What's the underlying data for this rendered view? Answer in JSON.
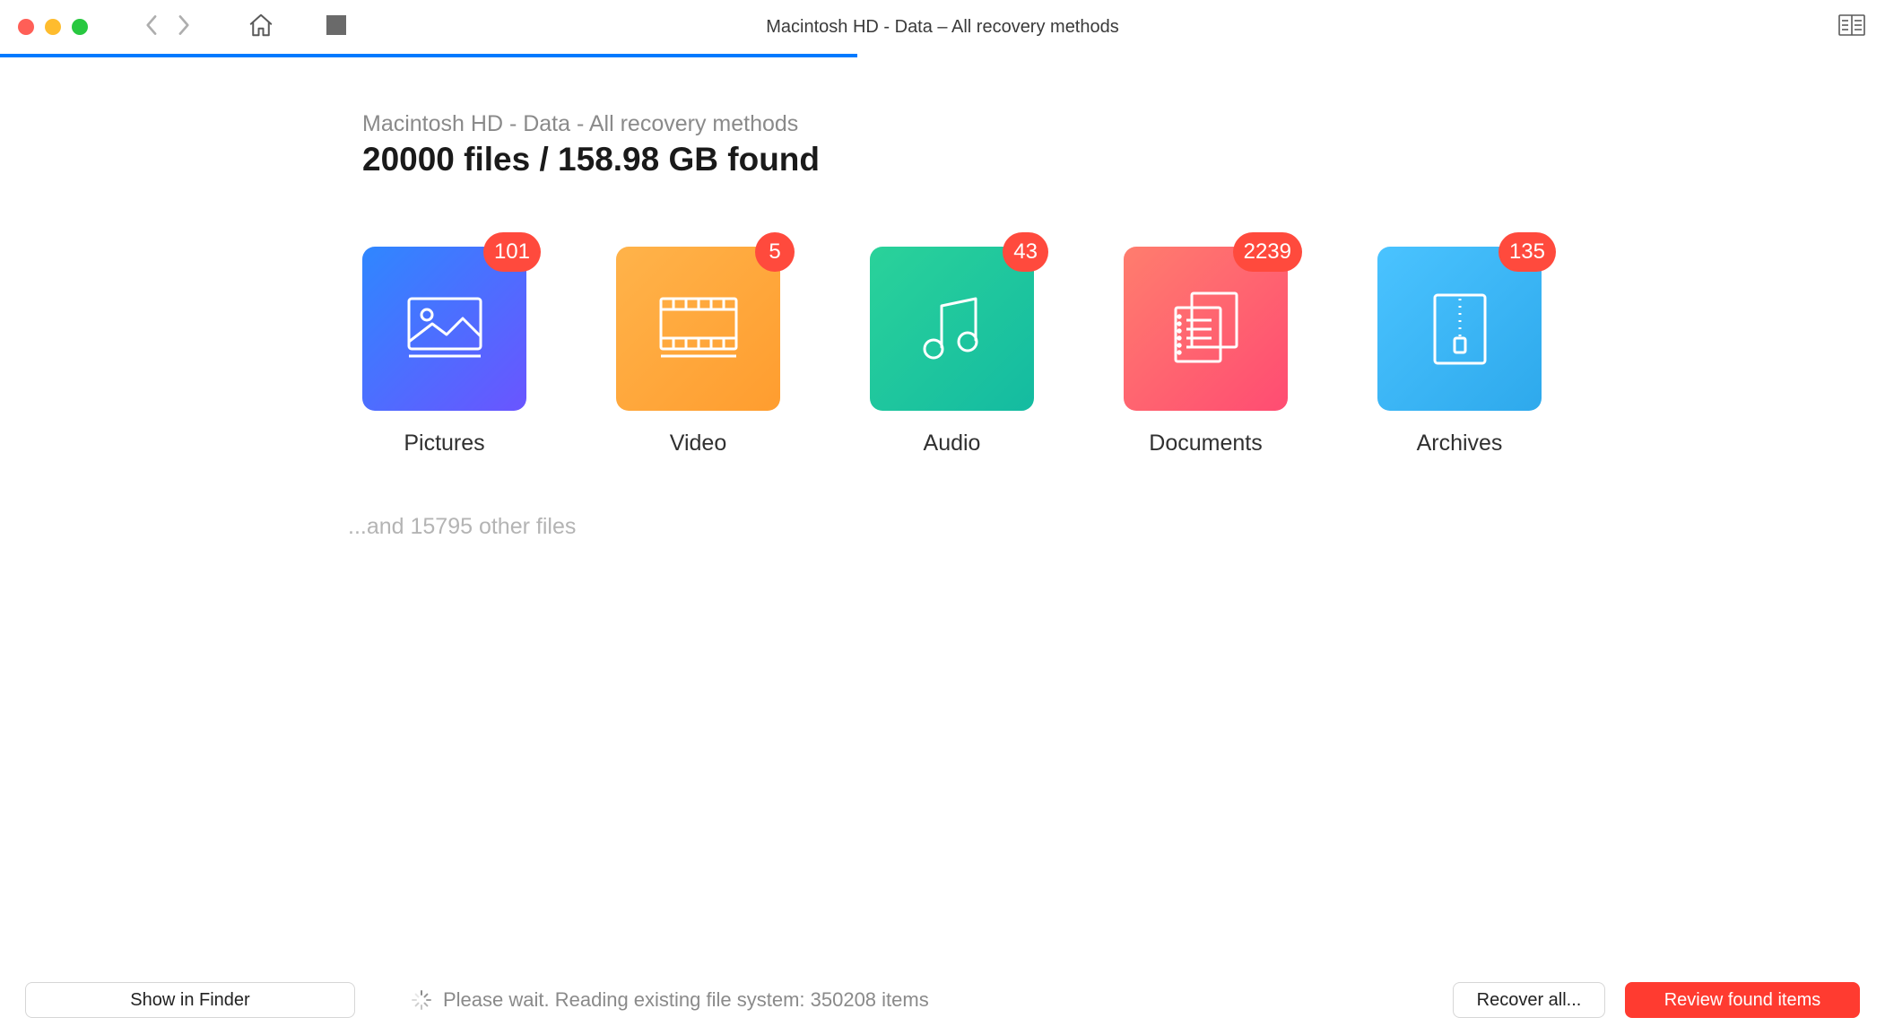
{
  "window": {
    "title": "Macintosh HD - Data – All recovery methods"
  },
  "progress": {
    "percent": 45.5
  },
  "header": {
    "breadcrumb": "Macintosh HD - Data - All recovery methods",
    "summary": "20000 files / 158.98 GB found"
  },
  "categories": [
    {
      "id": "pictures",
      "label": "Pictures",
      "count": "101",
      "tileClass": "tile-pictures",
      "icon": "image-icon"
    },
    {
      "id": "video",
      "label": "Video",
      "count": "5",
      "tileClass": "tile-video",
      "icon": "film-icon"
    },
    {
      "id": "audio",
      "label": "Audio",
      "count": "43",
      "tileClass": "tile-audio",
      "icon": "music-icon"
    },
    {
      "id": "documents",
      "label": "Documents",
      "count": "2239",
      "tileClass": "tile-documents",
      "icon": "documents-icon"
    },
    {
      "id": "archives",
      "label": "Archives",
      "count": "135",
      "tileClass": "tile-archives",
      "icon": "zip-icon"
    }
  ],
  "other_files_text": "...and 15795 other files",
  "footer": {
    "show_in_finder": "Show in Finder",
    "status_text": "Please wait. Reading existing file system: 350208 items",
    "recover_all": "Recover all...",
    "review": "Review found items"
  }
}
